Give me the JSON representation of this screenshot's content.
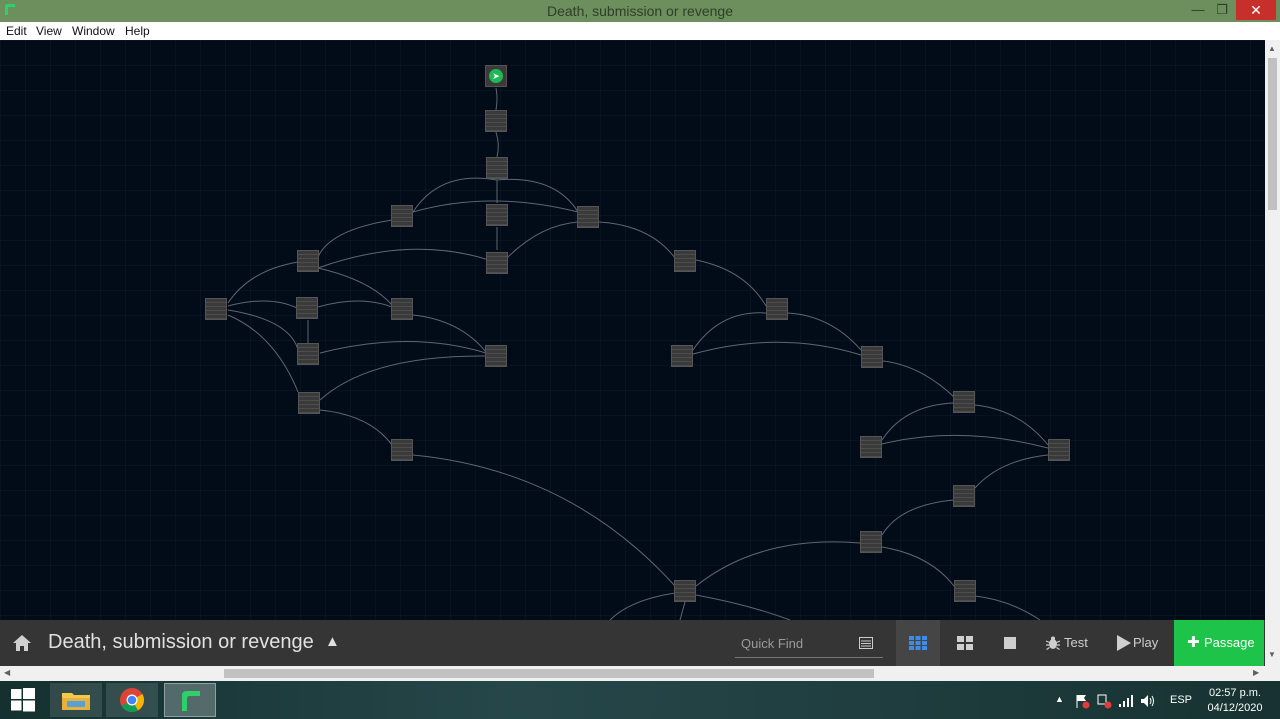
{
  "window": {
    "title": "Death, submission or revenge",
    "minimize_glyph": "—",
    "maximize_glyph": "❐",
    "close_glyph": "✕"
  },
  "menu": {
    "items": [
      "Edit",
      "View",
      "Window",
      "Help"
    ]
  },
  "toolbar": {
    "story_title": "Death, submission or revenge",
    "story_caret": "▲",
    "quick_find_placeholder": "Quick Find",
    "test_label": "Test",
    "play_label": "Play",
    "passage_label": "Passage",
    "passage_plus": "✚"
  },
  "colors": {
    "accent_green": "#1ec34a",
    "canvas_bg": "#020b18",
    "titlebar": "#6d8f5d",
    "close": "#c7302a"
  },
  "icons": {
    "home": "home-icon",
    "story_view_structure": "grid-small-icon",
    "story_view_titles": "grid-large-icon",
    "story_view_single": "square-icon",
    "test": "bug-icon",
    "play": "play-icon",
    "start": "rocket-icon"
  },
  "taskbar": {
    "apps": [
      "file-explorer",
      "chrome",
      "twine"
    ],
    "language": "ESP",
    "time": "02:57 p.m.",
    "date": "04/12/2020"
  }
}
